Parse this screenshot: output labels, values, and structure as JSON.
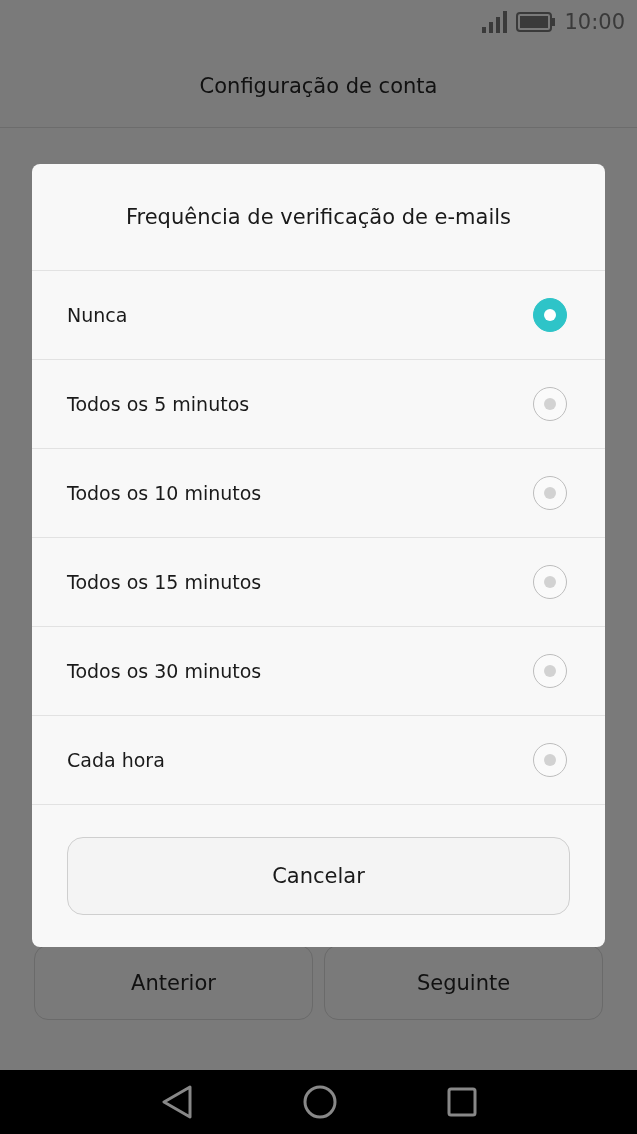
{
  "status_bar": {
    "time": "10:00"
  },
  "header": {
    "title": "Configuração de conta"
  },
  "footer_buttons": [
    "Anterior",
    "Seguinte"
  ],
  "dialog": {
    "title": "Frequência de verificação de e-mails",
    "options": [
      {
        "label": "Nunca",
        "selected": true
      },
      {
        "label": "Todos os 5 minutos",
        "selected": false
      },
      {
        "label": "Todos os 10 minutos",
        "selected": false
      },
      {
        "label": "Todos os 15 minutos",
        "selected": false
      },
      {
        "label": "Todos os 30 minutos",
        "selected": false
      },
      {
        "label": "Cada hora",
        "selected": false
      }
    ],
    "cancel_button": "Cancelar"
  }
}
